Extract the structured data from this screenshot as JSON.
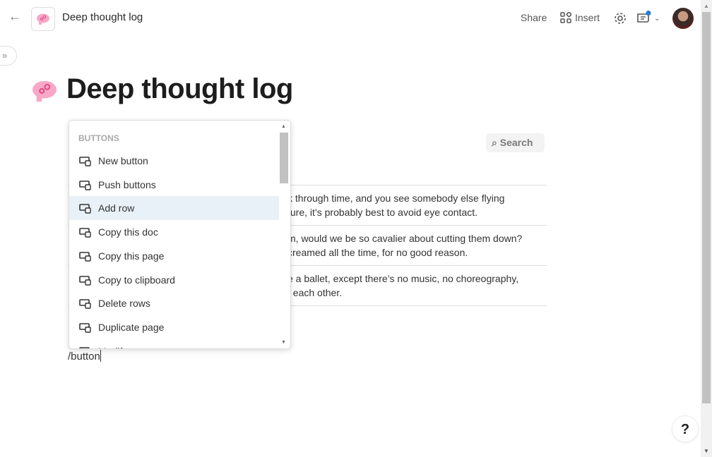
{
  "header": {
    "title": "Deep thought log",
    "share": "Share",
    "insert": "Insert",
    "back_icon": "arrow-left-icon",
    "doc_icon": "brain-gears-icon"
  },
  "page": {
    "title": "Deep thought log",
    "search_label": "Search"
  },
  "rows": [
    {
      "line1": "k through time, and you see somebody else flying",
      "line2": "ture, it’s probably best to avoid eye contact."
    },
    {
      "line1": "m, would we be so cavalier about cutting them down?",
      "line2": "creamed all the time, for no good reason."
    },
    {
      "line1": "e a ballet, except there’s no music, no choreography,",
      "line2": "t each other."
    }
  ],
  "menu": {
    "section": "BUTTONS",
    "items": [
      {
        "label": "New button",
        "icon": "button-cursor-icon"
      },
      {
        "label": "Push buttons",
        "icon": "push-buttons-icon"
      },
      {
        "label": "Add row",
        "icon": "add-row-icon",
        "highlighted": true
      },
      {
        "label": "Copy this doc",
        "icon": "copy-doc-icon"
      },
      {
        "label": "Copy this page",
        "icon": "copy-page-icon"
      },
      {
        "label": "Copy to clipboard",
        "icon": "clipboard-icon"
      },
      {
        "label": "Delete rows",
        "icon": "delete-rows-icon"
      },
      {
        "label": "Duplicate page",
        "icon": "duplicate-page-icon"
      },
      {
        "label": "Modify rows",
        "icon": "modify-rows-icon"
      }
    ]
  },
  "editor": {
    "command_text": "/button"
  },
  "help": "?",
  "colors": {
    "highlight": "#e8f1f8",
    "notification_dot": "#1a7fd4",
    "brain_pink": "#f7a8c8"
  }
}
